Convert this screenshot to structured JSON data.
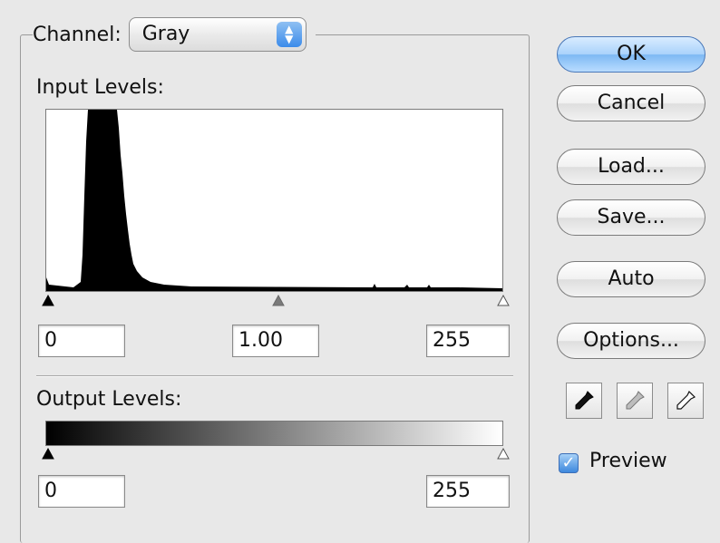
{
  "channel": {
    "label": "Channel:",
    "selected": "Gray",
    "arrows_icon": "updown-arrows-icon"
  },
  "input_levels": {
    "label": "Input Levels:",
    "black": "0",
    "gamma": "1.00",
    "white": "255"
  },
  "output_levels": {
    "label": "Output Levels:",
    "black": "0",
    "white": "255"
  },
  "buttons": {
    "ok": "OK",
    "cancel": "Cancel",
    "load": "Load...",
    "save": "Save...",
    "auto": "Auto",
    "options": "Options..."
  },
  "preview": {
    "label": "Preview",
    "checked": true
  },
  "eyedroppers": [
    "black-eyedropper-icon",
    "gray-eyedropper-icon",
    "white-eyedropper-icon"
  ]
}
